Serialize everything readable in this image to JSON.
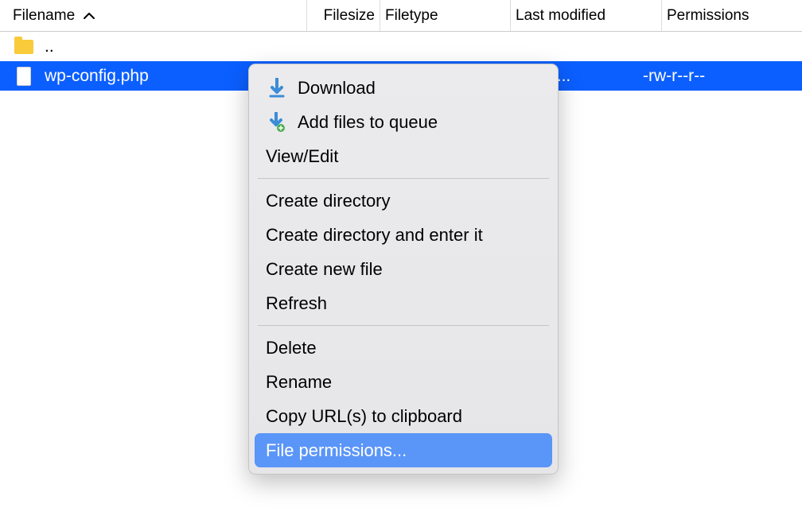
{
  "columns": {
    "filename": "Filename",
    "filesize": "Filesize",
    "filetype": "Filetype",
    "lastmod": "Last modified",
    "perms": "Permissions"
  },
  "sort": {
    "column": "filename",
    "direction": "asc"
  },
  "rows": [
    {
      "name": "..",
      "type": "parent-dir",
      "selected": false
    },
    {
      "name": "wp-config.php",
      "type": "file",
      "selected": true,
      "filesize": "",
      "filetype": "",
      "lastmod": "5/2022 1...",
      "perms": "-rw-r--r--"
    }
  ],
  "contextMenu": {
    "items": [
      {
        "label": "Download",
        "icon": "download-icon"
      },
      {
        "label": "Add files to queue",
        "icon": "queue-icon"
      }
    ],
    "group2": [
      {
        "label": "View/Edit"
      }
    ],
    "group3": [
      {
        "label": "Create directory"
      },
      {
        "label": "Create directory and enter it"
      },
      {
        "label": "Create new file"
      },
      {
        "label": "Refresh"
      }
    ],
    "group4": [
      {
        "label": "Delete"
      },
      {
        "label": "Rename"
      },
      {
        "label": "Copy URL(s) to clipboard"
      },
      {
        "label": "File permissions...",
        "highlighted": true
      }
    ]
  }
}
